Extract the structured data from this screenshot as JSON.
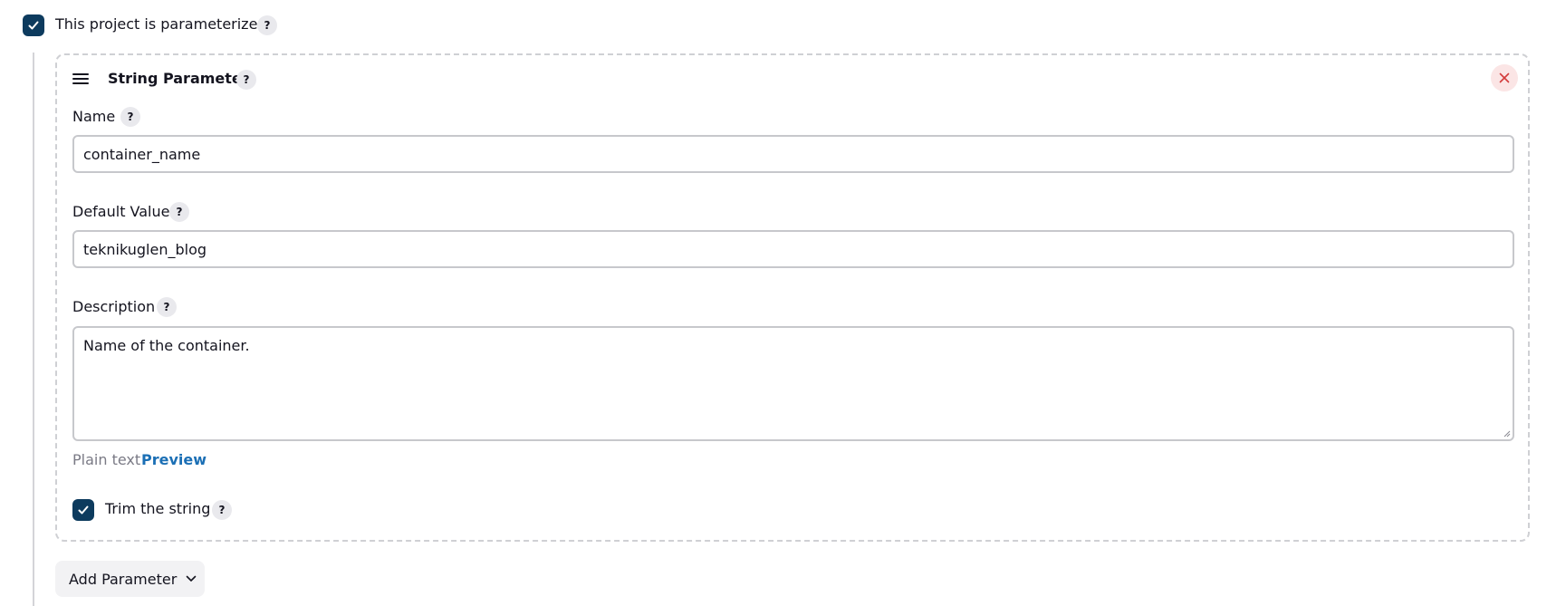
{
  "parameterized": {
    "label": "This project is parameterized",
    "checked": true,
    "help": "?"
  },
  "string_parameter": {
    "title": "String Parameter",
    "help": "?",
    "name": {
      "label": "Name",
      "help": "?",
      "value": "container_name"
    },
    "default_value": {
      "label": "Default Value",
      "help": "?",
      "value": "teknikuglen_blog"
    },
    "description": {
      "label": "Description",
      "help": "?",
      "value": "Name of the container.",
      "format_label": "Plain text",
      "preview_label": "Preview"
    },
    "trim": {
      "label": "Trim the string",
      "checked": true,
      "help": "?"
    }
  },
  "add_parameter": {
    "label": "Add Parameter"
  },
  "colors": {
    "checkbox": "#0d3b5e",
    "link": "#1b6fb5",
    "close": "#d33b3b"
  }
}
